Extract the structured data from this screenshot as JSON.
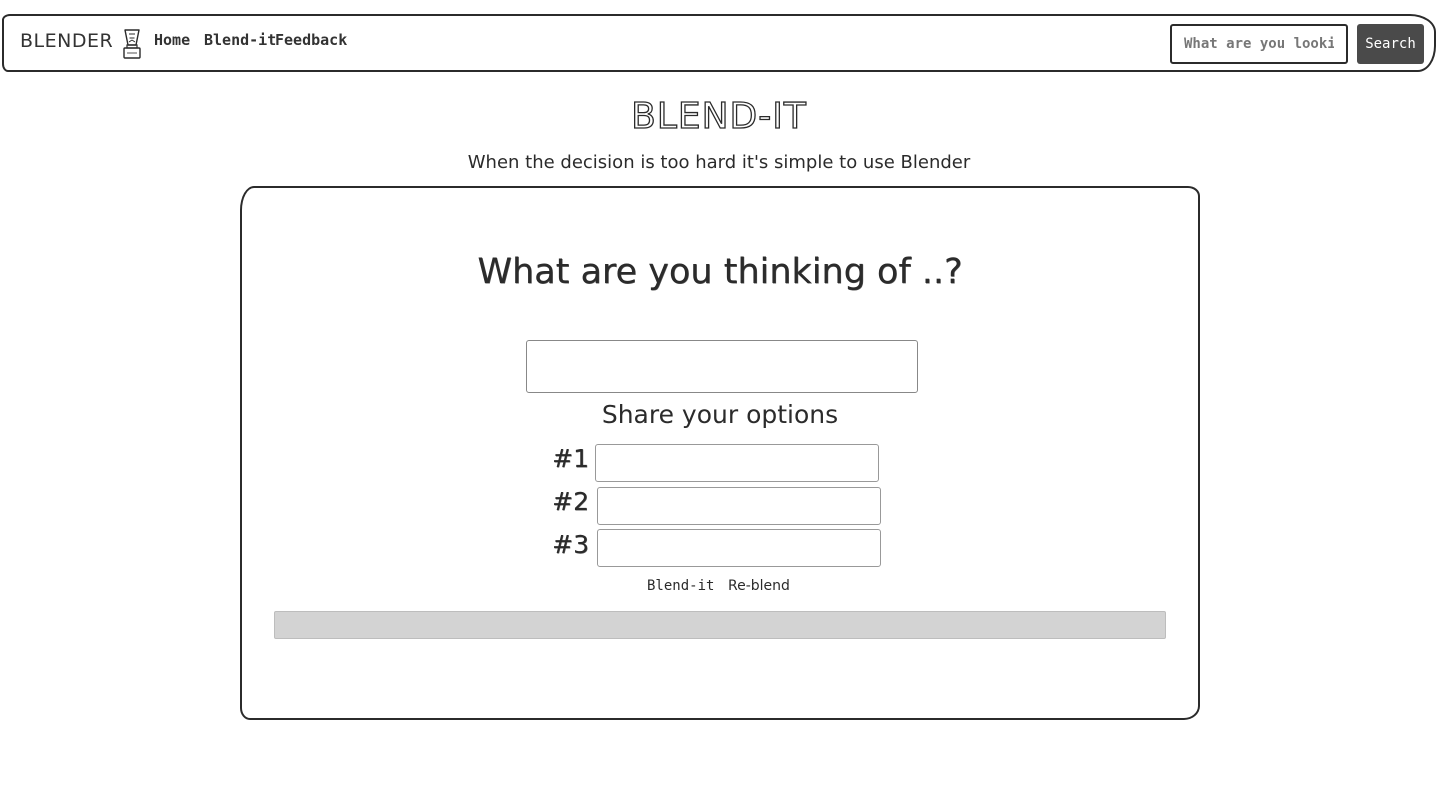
{
  "navbar": {
    "brand": "BLENDER",
    "logo_icon": "blender-icon",
    "links": [
      {
        "label": "Home"
      },
      {
        "label": "Blend-it"
      },
      {
        "label": "Feedback"
      }
    ],
    "search": {
      "placeholder": "What are you looking for?",
      "button_label": "Search"
    }
  },
  "header": {
    "title": "BLEND-IT",
    "subtitle": "When the decision is too hard it's simple to use Blender"
  },
  "card": {
    "question": "What are you thinking of ..?",
    "question_value": "",
    "options_heading": "Share your options",
    "options": [
      {
        "label": "#1",
        "value": ""
      },
      {
        "label": "#2",
        "value": ""
      },
      {
        "label": "#3",
        "value": ""
      }
    ],
    "blend_button": "Blend-it",
    "reblend_button": "Re-blend",
    "result_text": ""
  },
  "colors": {
    "ink": "#2b2b2b",
    "search_button_bg": "#4a4a4a",
    "result_bar_bg": "#d3d3d3",
    "background": "#ffffff"
  }
}
